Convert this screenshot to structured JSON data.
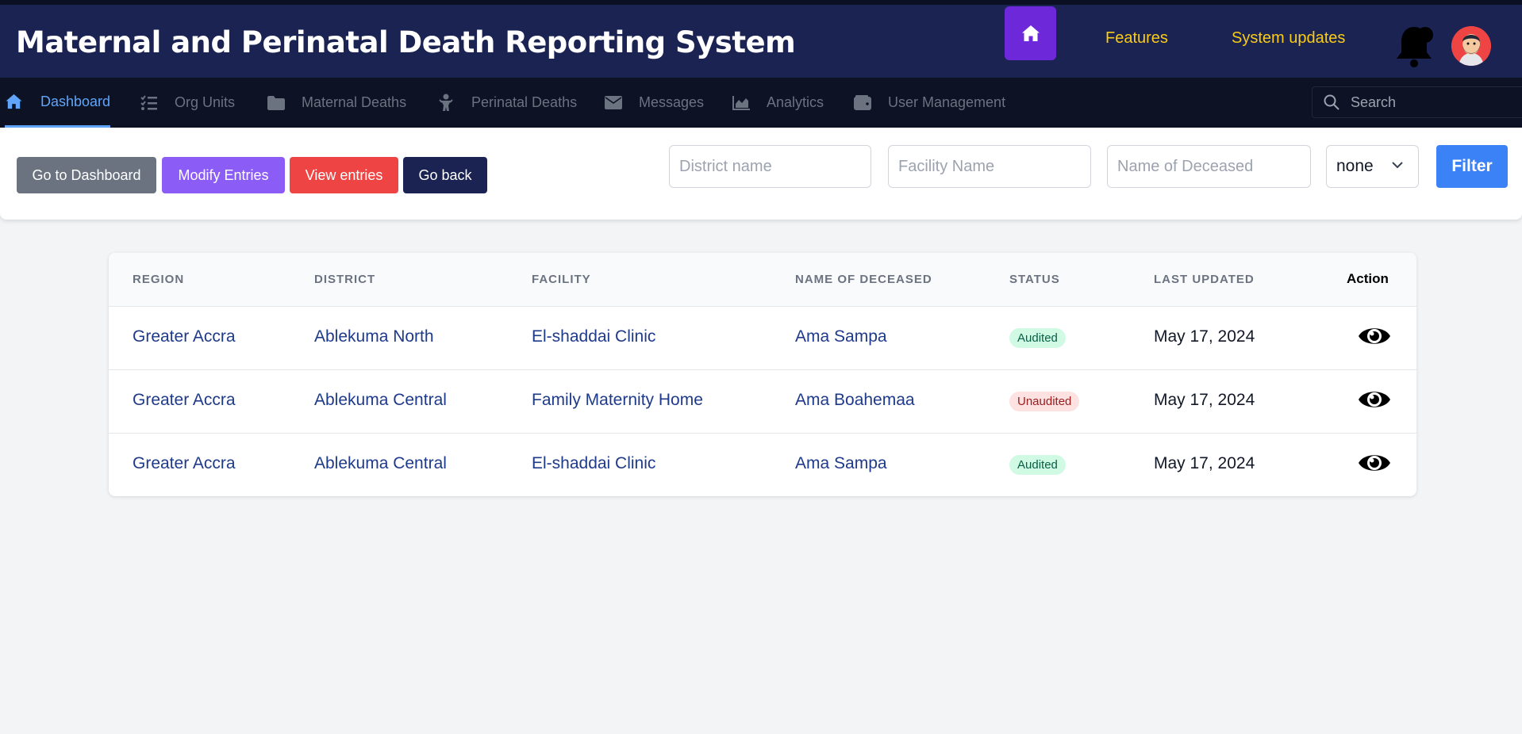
{
  "header": {
    "title": "Maternal and Perinatal Death Reporting System",
    "links": [
      "Features",
      "System updates"
    ],
    "home_icon": "home-icon",
    "notification_icon": "bell-icon",
    "avatar": "user-avatar"
  },
  "nav": {
    "items": [
      {
        "label": "Dashboard",
        "icon": "home-icon",
        "active": true
      },
      {
        "label": "Org Units",
        "icon": "checklist-icon"
      },
      {
        "label": "Maternal Deaths",
        "icon": "folder-icon"
      },
      {
        "label": "Perinatal Deaths",
        "icon": "baby-icon"
      },
      {
        "label": "Messages",
        "icon": "envelope-icon"
      },
      {
        "label": "Analytics",
        "icon": "chart-icon"
      },
      {
        "label": "User Management",
        "icon": "wallet-icon"
      }
    ],
    "search_placeholder": "Search"
  },
  "toolbar": {
    "buttons": [
      {
        "label": "Go to Dashboard",
        "color": "#6b7280"
      },
      {
        "label": "Modify Entries",
        "color": "#8b5cf6"
      },
      {
        "label": "View entries",
        "color": "#ef4444"
      },
      {
        "label": "Go back",
        "color": "#1a2352"
      }
    ],
    "district_placeholder": "District name",
    "facility_placeholder": "Facility Name",
    "deceased_placeholder": "Name of Deceased",
    "status_select": "none",
    "filter_label": "Filter"
  },
  "table": {
    "columns": [
      "Region",
      "District",
      "Facility",
      "Name of Deceased",
      "Status",
      "Last Updated",
      "Action"
    ],
    "rows": [
      {
        "region": "Greater Accra",
        "district": "Ablekuma North",
        "facility": "El-shaddai Clinic",
        "deceased": "Ama Sampa",
        "status": "Audited",
        "updated": "May 17, 2024"
      },
      {
        "region": "Greater Accra",
        "district": "Ablekuma Central",
        "facility": "Family Maternity Home",
        "deceased": "Ama Boahemaa",
        "status": "Unaudited",
        "updated": "May 17, 2024"
      },
      {
        "region": "Greater Accra",
        "district": "Ablekuma Central",
        "facility": "El-shaddai Clinic",
        "deceased": "Ama Sampa",
        "status": "Audited",
        "updated": "May 17, 2024"
      }
    ],
    "action_icon": "eye-icon"
  }
}
